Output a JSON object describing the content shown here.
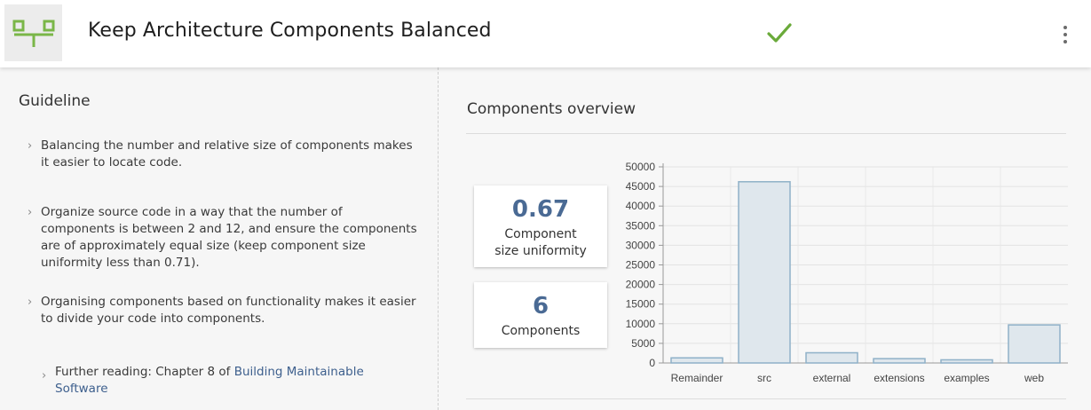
{
  "header": {
    "title": "Keep Architecture Components Balanced",
    "status_icon": "checkmark-icon",
    "colors": {
      "brand_green": "#7ab648",
      "check_green": "#6aaa3a"
    }
  },
  "guideline": {
    "title": "Guideline",
    "items": [
      "Balancing the number and relative size of components makes it easier to locate code.",
      "Organize source code in a way that the number of components is between 2 and 12, and ensure the components are of approximately equal size (keep component size uniformity less than 0.71).",
      "Organising components based on functionality makes it easier to divide your code into components."
    ],
    "further_prefix": "Further reading: Chapter 8 of ",
    "further_link": "Building Maintainable Software"
  },
  "overview": {
    "title": "Components overview",
    "cards": [
      {
        "value": "0.67",
        "label": "Component size uniformity"
      },
      {
        "value": "6",
        "label": "Components"
      }
    ]
  },
  "chart_data": {
    "type": "bar",
    "categories": [
      "Remainder",
      "src",
      "external",
      "extensions",
      "examples",
      "web"
    ],
    "values": [
      1300,
      46200,
      2600,
      1100,
      800,
      9700
    ],
    "yticks": [
      0,
      5000,
      10000,
      15000,
      20000,
      25000,
      30000,
      35000,
      40000,
      45000,
      50000
    ],
    "ylim": [
      0,
      50000
    ],
    "bar_fill": "#dfe7ed",
    "bar_stroke": "#8fb1c8",
    "grid": true
  }
}
